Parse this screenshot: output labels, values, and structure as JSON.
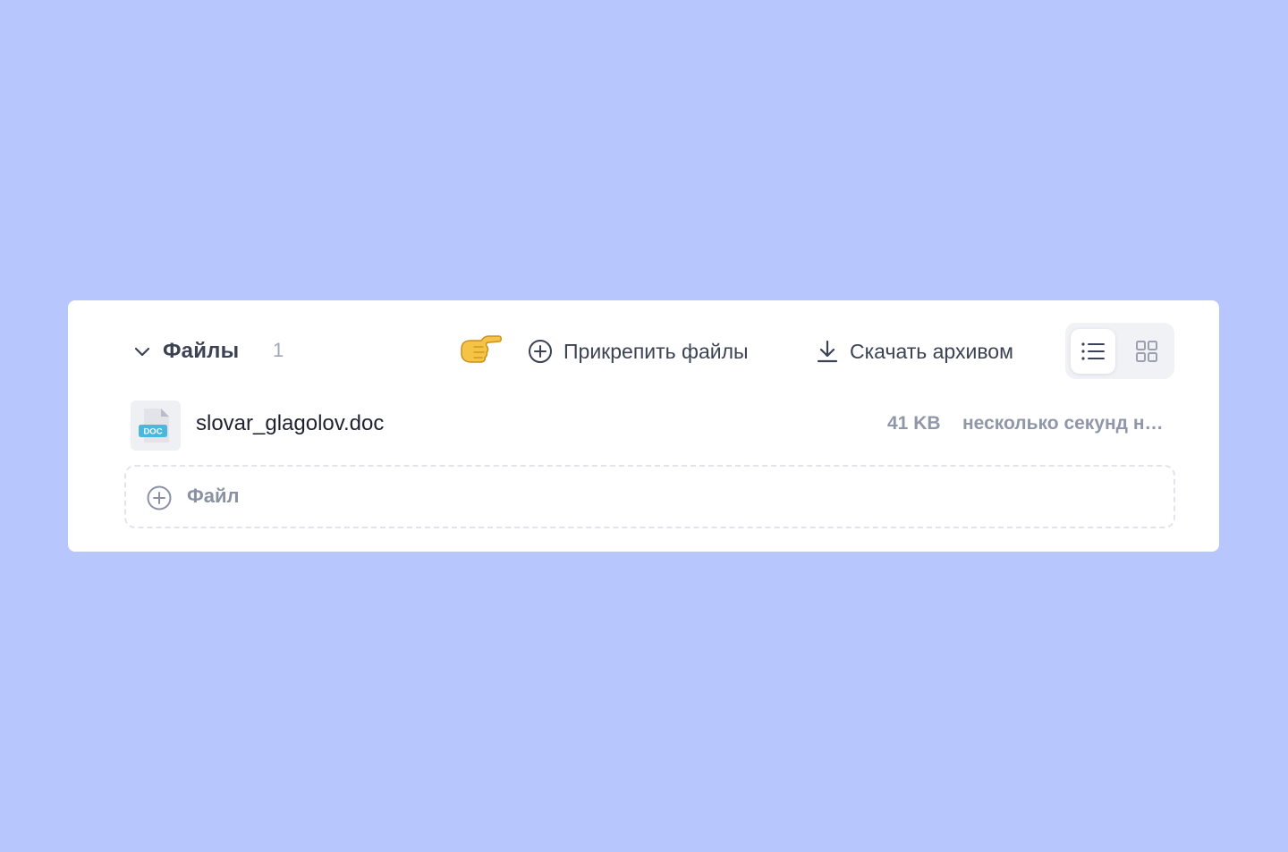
{
  "files_section": {
    "title": "Файлы",
    "count": "1",
    "actions": {
      "attach_label": "Прикрепить файлы",
      "download_label": "Скачать архивом"
    },
    "view_modes": {
      "selected": "list",
      "options": [
        "list-icon",
        "grid-icon"
      ]
    },
    "files": [
      {
        "name": "slovar_glagolov.doc",
        "type_badge": "DOC",
        "size": "41 KB",
        "time": "несколько секунд назад"
      }
    ],
    "add_file_label": "Файл"
  },
  "colors": {
    "background": "#b8c6fe",
    "panel": "#ffffff",
    "doc_badge": "#4ab8de",
    "text_primary": "#3b4253",
    "text_muted": "#9097a8"
  }
}
